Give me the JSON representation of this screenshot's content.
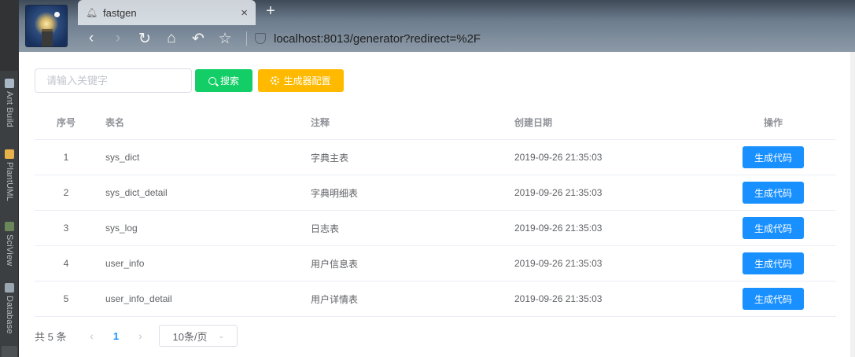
{
  "ide": {
    "tools": [
      "Ant Build",
      "PlantUML",
      "SciView",
      "Database"
    ]
  },
  "browser": {
    "tab_title": "fastgen",
    "tab_close": "×",
    "new_tab": "+",
    "url": "localhost:8013/generator?redirect=%2F",
    "nav": {
      "back": "‹",
      "forward": "›",
      "reload": "↻",
      "home": "⌂",
      "undo": "↶",
      "bookmark": "☆"
    }
  },
  "toolbar": {
    "search_placeholder": "请输入关键字",
    "search_label": "搜索",
    "config_label": "生成器配置"
  },
  "table": {
    "columns": [
      "序号",
      "表名",
      "注释",
      "创建日期",
      "操作"
    ],
    "rows": [
      {
        "index": "1",
        "name": "sys_dict",
        "remark": "字典主表",
        "date": "2019-09-26 21:35:03",
        "action": "生成代码"
      },
      {
        "index": "2",
        "name": "sys_dict_detail",
        "remark": "字典明细表",
        "date": "2019-09-26 21:35:03",
        "action": "生成代码"
      },
      {
        "index": "3",
        "name": "sys_log",
        "remark": "日志表",
        "date": "2019-09-26 21:35:03",
        "action": "生成代码"
      },
      {
        "index": "4",
        "name": "user_info",
        "remark": "用户信息表",
        "date": "2019-09-26 21:35:03",
        "action": "生成代码"
      },
      {
        "index": "5",
        "name": "user_info_detail",
        "remark": "用户详情表",
        "date": "2019-09-26 21:35:03",
        "action": "生成代码"
      }
    ]
  },
  "pagination": {
    "total": "共 5 条",
    "prev": "‹",
    "current": "1",
    "next": "›",
    "page_size": "10条/页",
    "chevron": "⌄"
  },
  "colors": {
    "search_button": "#13ce66",
    "config_button": "#ffba00",
    "primary": "#1890ff"
  }
}
